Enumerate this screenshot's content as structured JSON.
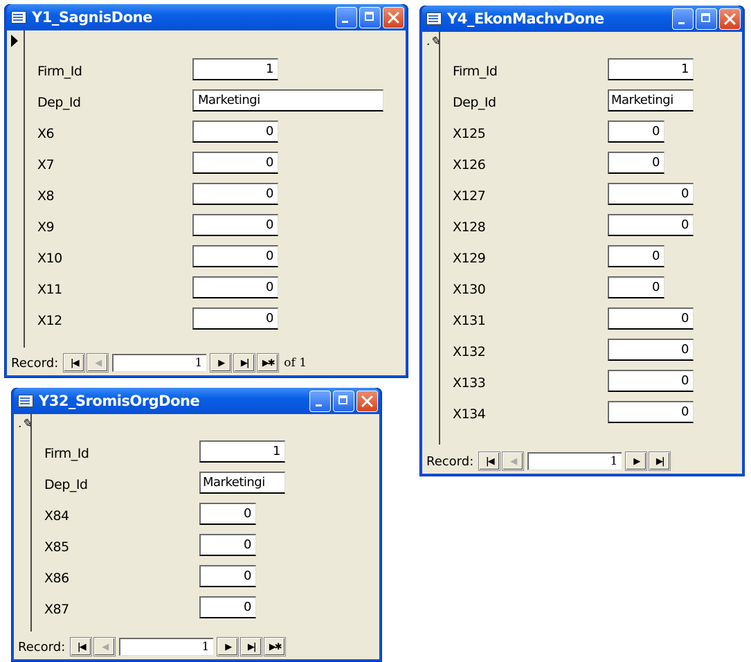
{
  "windows": [
    {
      "title": "Y1_SagnisDone",
      "selector": "current-record",
      "fields": [
        {
          "label": "Firm_Id",
          "value": "1"
        },
        {
          "label": "Dep_Id",
          "value": "Marketingi"
        },
        {
          "label": "X6",
          "value": "0"
        },
        {
          "label": "X7",
          "value": "0"
        },
        {
          "label": "X8",
          "value": "0"
        },
        {
          "label": "X9",
          "value": "0"
        },
        {
          "label": "X10",
          "value": "0"
        },
        {
          "label": "X11",
          "value": "0"
        },
        {
          "label": "X12",
          "value": "0"
        }
      ],
      "record": {
        "label": "Record:",
        "current": "1",
        "of_label": "of 1"
      }
    },
    {
      "title": "Y4_EkonMachvDone",
      "selector": "editing",
      "fields": [
        {
          "label": "Firm_Id",
          "value": "1"
        },
        {
          "label": "Dep_Id",
          "value": "Marketingi"
        },
        {
          "label": "X125",
          "value": "0"
        },
        {
          "label": "X126",
          "value": "0"
        },
        {
          "label": "X127",
          "value": "0"
        },
        {
          "label": "X128",
          "value": "0"
        },
        {
          "label": "X129",
          "value": "0"
        },
        {
          "label": "X130",
          "value": "0"
        },
        {
          "label": "X131",
          "value": "0"
        },
        {
          "label": "X132",
          "value": "0"
        },
        {
          "label": "X133",
          "value": "0"
        },
        {
          "label": "X134",
          "value": "0"
        }
      ],
      "record": {
        "label": "Record:",
        "current": "1"
      }
    },
    {
      "title": "Y32_SromisOrgDone",
      "selector": "editing",
      "fields": [
        {
          "label": "Firm_Id",
          "value": "1"
        },
        {
          "label": "Dep_Id",
          "value": "Marketingi"
        },
        {
          "label": "X84",
          "value": "0"
        },
        {
          "label": "X85",
          "value": "0"
        },
        {
          "label": "X86",
          "value": "0"
        },
        {
          "label": "X87",
          "value": "0"
        }
      ],
      "record": {
        "label": "Record:",
        "current": "1"
      }
    }
  ],
  "nav_glyphs": {
    "first": "|◀",
    "prev": "◀",
    "next": "▶",
    "last": "▶|",
    "new": "▶✱"
  },
  "icons": [
    "form-icon",
    "minimize-icon",
    "maximize-icon",
    "close-icon",
    "record-selector-arrow-icon",
    "pencil-icon"
  ],
  "colors": {
    "titlebar": "#0a5fe6",
    "client": "#ece9d8",
    "close": "#d3451f"
  }
}
